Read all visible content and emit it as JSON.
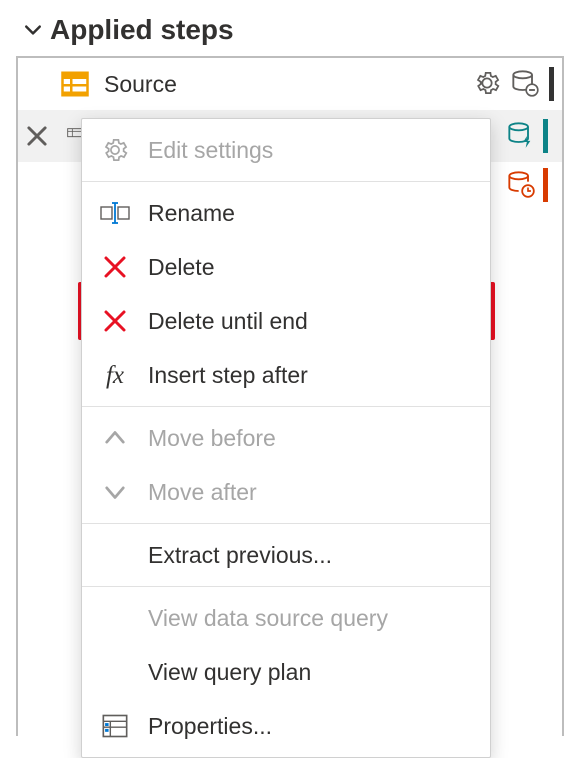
{
  "panel": {
    "title": "Applied steps"
  },
  "steps": {
    "source_label": "Source"
  },
  "menu": {
    "edit_settings": "Edit settings",
    "rename": "Rename",
    "delete": "Delete",
    "delete_until_end": "Delete until end",
    "insert_step_after": "Insert step after",
    "move_before": "Move before",
    "move_after": "Move after",
    "extract_previous": "Extract previous...",
    "view_data_source_query": "View data source query",
    "view_query_plan": "View query plan",
    "properties": "Properties..."
  }
}
